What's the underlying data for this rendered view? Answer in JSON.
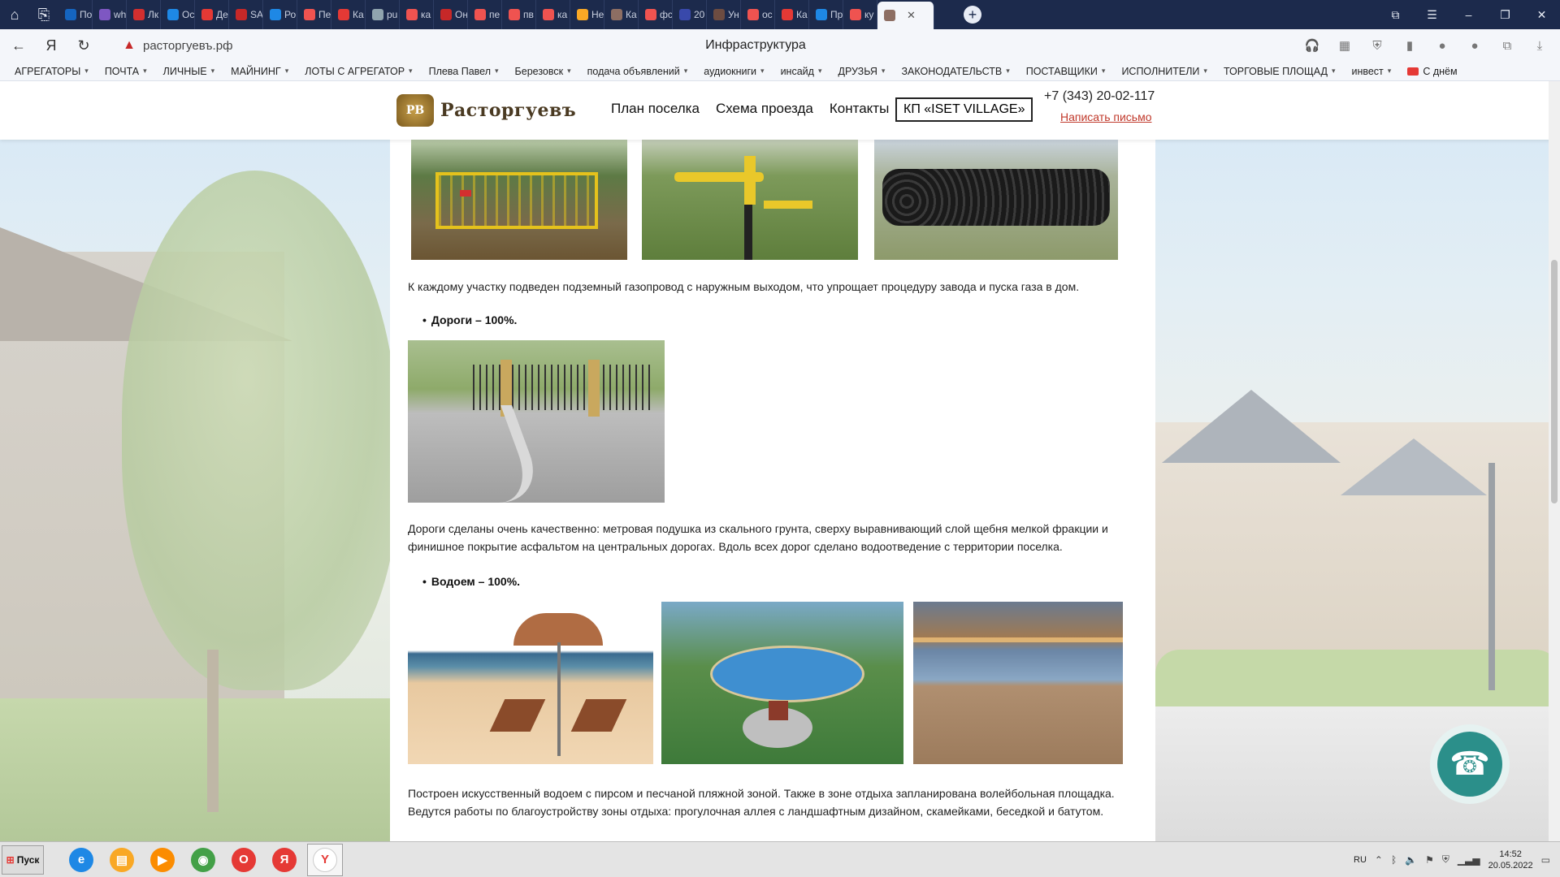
{
  "browser": {
    "tabs": [
      {
        "label": "По",
        "icon": "mail-icon",
        "color": "#1565c0"
      },
      {
        "label": "wh",
        "icon": "dots-icon",
        "color": "#7e57c2"
      },
      {
        "label": "Лк",
        "icon": "bank-icon",
        "color": "#d32f2f"
      },
      {
        "label": "Ос",
        "icon": "flag-icon",
        "color": "#1e88e5"
      },
      {
        "label": "Де",
        "icon": "pin-icon",
        "color": "#e53935"
      },
      {
        "label": "SA",
        "icon": "s-icon",
        "color": "#c62828"
      },
      {
        "label": "Ро",
        "icon": "c-icon",
        "color": "#1e88e5"
      },
      {
        "label": "Пе",
        "icon": "yandex-icon",
        "color": "#ef5350"
      },
      {
        "label": "Ка",
        "icon": "pin-icon",
        "color": "#e53935"
      },
      {
        "label": "pu",
        "icon": "doc-icon",
        "color": "#90a4ae"
      },
      {
        "label": "ка",
        "icon": "yandex-icon",
        "color": "#ef5350"
      },
      {
        "label": "Он",
        "icon": "o-icon",
        "color": "#c62828"
      },
      {
        "label": "пе",
        "icon": "yandex-icon",
        "color": "#ef5350"
      },
      {
        "label": "пв",
        "icon": "yandex-icon",
        "color": "#ef5350"
      },
      {
        "label": "ка",
        "icon": "yandex-icon",
        "color": "#ef5350"
      },
      {
        "label": "Не",
        "icon": "k-icon",
        "color": "#f9a825"
      },
      {
        "label": "Ка",
        "icon": "box-icon",
        "color": "#8d6e63"
      },
      {
        "label": "фс",
        "icon": "yandex-icon",
        "color": "#ef5350"
      },
      {
        "label": "20",
        "icon": "cube-icon",
        "color": "#3949ab"
      },
      {
        "label": "Ун",
        "icon": "face-icon",
        "color": "#6d4c41"
      },
      {
        "label": "ос",
        "icon": "yandex-icon",
        "color": "#ef5350"
      },
      {
        "label": "Ка",
        "icon": "check-icon",
        "color": "#e53935"
      },
      {
        "label": "Пр",
        "icon": "flag-icon",
        "color": "#1e88e5"
      },
      {
        "label": "ку",
        "icon": "yandex-icon",
        "color": "#ef5350"
      }
    ],
    "active_tab": {
      "label": "",
      "icon": "site-favicon"
    },
    "address": "расторгуевъ.рф",
    "title": "Инфраструктура"
  },
  "bookmarks": [
    "АГРЕГАТОРЫ",
    "ПОЧТА",
    "ЛИЧНЫЕ",
    "МАЙНИНГ",
    "ЛОТЫ С АГРЕГАТОР",
    "Плева Павел",
    "Березовск",
    "подача объявлений",
    "аудиокниги",
    "инсайд",
    "ДРУЗЬЯ",
    "ЗАКОНОДАТЕЛЬСТВ",
    "ПОСТАВЩИКИ",
    "ИСПОЛНИТЕЛИ",
    "ТОРГОВЫЕ ПЛОЩАД",
    "инвест"
  ],
  "bookmark_last": "С днём",
  "site": {
    "logo_text": "Расторгуевъ",
    "logo_emblem": "РВ",
    "nav": [
      "План поселка",
      "Схема проезда",
      "Контакты"
    ],
    "kp_button": "КП «ISET VILLAGE»",
    "phone": "+7 (343) 20-02-117",
    "mail_link": "Написать письмо"
  },
  "content": {
    "gas_text": "К каждому участку подведен  подземный газопровод  с наружным выходом, что упрощает процедуру завода и пуска газа в дом.",
    "roads_heading": "Дороги  –  100%.",
    "roads_text": "Дороги сделаны очень качественно: метровая подушка из скального грунта, сверху выравнивающий слой щебня мелкой фракции и финишное покрытие асфальтом на центральных дорогах. Вдоль всех дорог сделано водоотведение с территории поселка.",
    "pond_heading": "Водоем  –  100%.",
    "pond_text": " Построен искусственный водоем с пирсом и песчаной пляжной зоной. Также в зоне отдыха запланирована волейбольная площадка. Ведутся работы по благоустройству зоны отдыха: прогулочная аллея с ландшафтным дизайном, скамейками,  беседкой и батутом."
  },
  "taskbar": {
    "start_label": "Пуск",
    "apps": [
      {
        "name": "ie-icon",
        "color": "#1e88e5",
        "glyph": "e"
      },
      {
        "name": "folder-icon",
        "color": "#f9a825",
        "glyph": "▤"
      },
      {
        "name": "media-icon",
        "color": "#fb8c00",
        "glyph": "▶"
      },
      {
        "name": "chrome-icon",
        "color": "#43a047",
        "glyph": "◉"
      },
      {
        "name": "opera-icon",
        "color": "#e53935",
        "glyph": "O"
      },
      {
        "name": "yandex-icon",
        "color": "#e53935",
        "glyph": "Я"
      },
      {
        "name": "yandex-browser-icon",
        "color": "#ffffff",
        "glyph": "Y"
      }
    ],
    "lang": "RU",
    "time": "14:52",
    "date": "20.05.2022"
  }
}
